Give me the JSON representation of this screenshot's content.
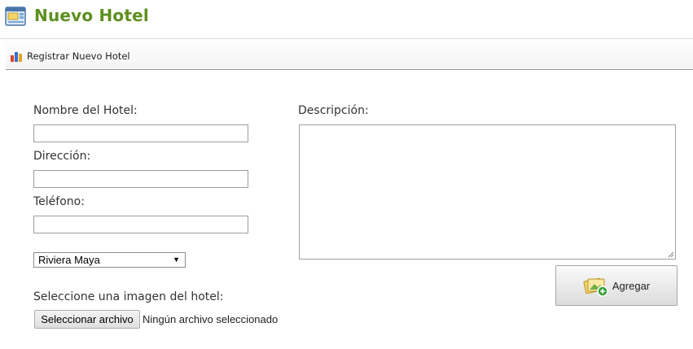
{
  "header": {
    "title": "Nuevo Hotel",
    "icon": "hotel-window-icon"
  },
  "toolbar": {
    "register_link": "Registrar Nuevo Hotel",
    "icon": "bar-chart-icon"
  },
  "form": {
    "name_label": "Nombre del Hotel:",
    "name_value": "",
    "address_label": "Dirección:",
    "address_value": "",
    "phone_label": "Teléfono:",
    "phone_value": "",
    "region_selected": "Riviera Maya",
    "description_label": "Descripción:",
    "description_value": "",
    "image_label": "Seleccione una imagen del hotel:",
    "file_button": "Seleccionar archivo",
    "file_status": "Ningún archivo seleccionado",
    "submit_label": "Agregar",
    "submit_icon": "add-image-icon"
  },
  "colors": {
    "title": "#5d8f1e"
  }
}
